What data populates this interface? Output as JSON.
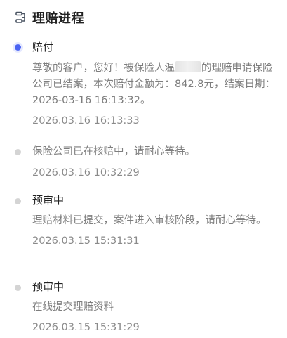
{
  "header": {
    "title": "理赔进程",
    "icon": "progress-list-icon"
  },
  "colors": {
    "accent": "#4a63f2",
    "dot_inactive": "#d4d4d4",
    "title": "#222222",
    "text_muted": "#7d7d7d"
  },
  "timeline": [
    {
      "title": "赔付",
      "desc_before": "尊敬的客户，您好！被保险人温",
      "desc_after": "的理赔申请保险公司已结案，本次赔付金额为：842.8元，结案日期：2026-03-16 16:13:32。",
      "time": "2026.03.16 16:13:33"
    },
    {
      "desc": "保险公司已在核赔中，请耐心等待。",
      "time": "2026.03.16 10:32:29"
    },
    {
      "title": "预审中",
      "desc": "理赔材料已提交，案件进入审核阶段，请耐心等待。",
      "time": "2026.03.15 15:31:31"
    },
    {
      "title": "预审中",
      "desc": "在线提交理赔资料",
      "time": "2026.03.15 15:31:29"
    }
  ]
}
